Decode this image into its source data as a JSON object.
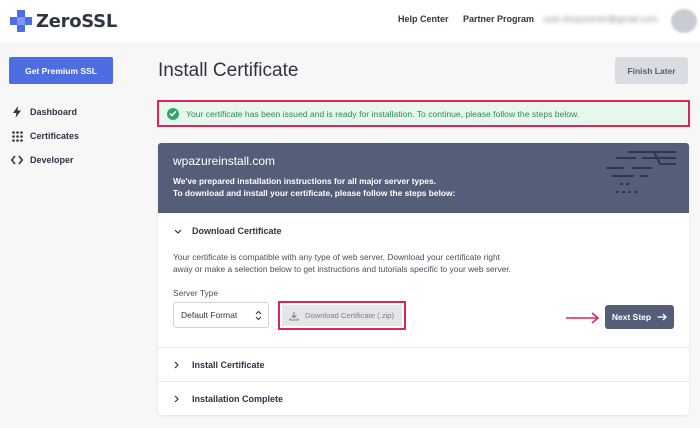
{
  "brand": {
    "name": "ZeroSSL",
    "accent": "#4d6ee3"
  },
  "topnav": {
    "help": "Help Center",
    "partner": "Partner Program",
    "email": "user.shopcorner@gmail.com"
  },
  "sidebar": {
    "premium_button": "Get Premium SSL",
    "items": [
      {
        "label": "Dashboard",
        "icon": "lightning-icon"
      },
      {
        "label": "Certificates",
        "icon": "grid-icon"
      },
      {
        "label": "Developer",
        "icon": "code-icon"
      }
    ]
  },
  "main": {
    "title": "Install Certificate",
    "finish_button": "Finish Later",
    "alert": "Your certificate has been issued and is ready for installation. To continue, please follow the steps below.",
    "card": {
      "domain": "wpazureinstall.com",
      "intro_line1": "We've prepared installation instructions for all major server types.",
      "intro_line2": "To download and install your certificate, please follow the steps below:",
      "steps": [
        {
          "label": "Download Certificate",
          "expanded": true
        },
        {
          "label": "Install Certificate",
          "expanded": false
        },
        {
          "label": "Installation Complete",
          "expanded": false
        }
      ],
      "download": {
        "desc_line1": "Your certificate is compatible with any type of web server. Download your certificate right",
        "desc_line2": "away or make a selection below to get instructions and tutorials specific to your web server.",
        "server_type_label": "Server Type",
        "server_type_value": "Default Format",
        "download_button": "Download Certificate (.zip)",
        "next_button": "Next Step"
      }
    }
  },
  "colors": {
    "alert_border": "#e0245a",
    "alert_bg": "#e7f7ee",
    "header_bg": "#555e79"
  }
}
